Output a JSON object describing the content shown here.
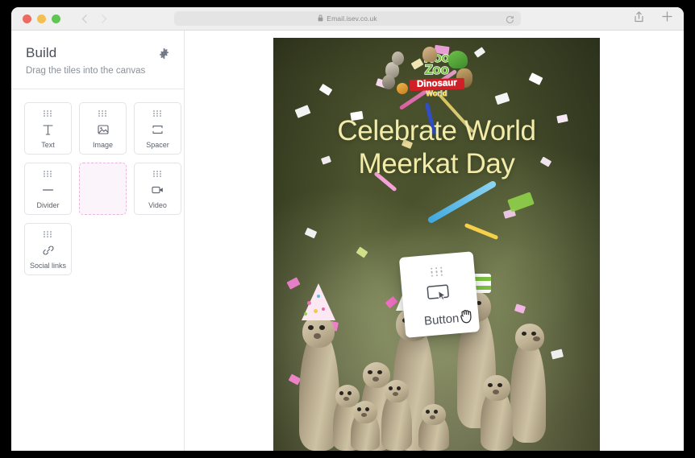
{
  "browser": {
    "window_controls": [
      "close",
      "minimize",
      "maximize"
    ],
    "url": "Email.isev.co.uk",
    "lock_icon": "lock-icon",
    "reload_icon": "reload-icon",
    "share_icon": "share-icon",
    "new_tab_icon": "plus-icon",
    "back_icon": "chevron-left-icon",
    "forward_icon": "chevron-right-icon"
  },
  "sidebar": {
    "title": "Build",
    "subtitle": "Drag the tiles into the canvas",
    "settings_icon": "gear-icon",
    "tiles": [
      {
        "label": "Text",
        "icon": "text-icon",
        "state": "normal"
      },
      {
        "label": "Image",
        "icon": "image-icon",
        "state": "normal"
      },
      {
        "label": "Spacer",
        "icon": "spacer-icon",
        "state": "normal"
      },
      {
        "label": "Divider",
        "icon": "divider-icon",
        "state": "normal"
      },
      {
        "label": "",
        "icon": "",
        "state": "empty-placeholder"
      },
      {
        "label": "Video",
        "icon": "video-icon",
        "state": "normal"
      },
      {
        "label": "Social links",
        "icon": "link-icon",
        "state": "normal"
      }
    ]
  },
  "drag": {
    "label": "Button",
    "icon": "button-cursor-icon",
    "cursor": "grabbing-hand-icon"
  },
  "email": {
    "logo": {
      "line1": "Hoo",
      "line2": "Zoo",
      "line3": "Dinosaur",
      "line4": "World",
      "ampersand": "&"
    },
    "headline_line1": "Celebrate World",
    "headline_line2": "Meerkat Day",
    "headline_color": "#f2eca8",
    "photo_description": "meerkats-with-party-hats"
  },
  "colors": {
    "accent_pink": "#e9b6e0",
    "placeholder_fill": "#fcf4fb",
    "logo_green": "#7ac143",
    "logo_red": "#cf2027",
    "logo_yellow": "#f6d332",
    "sidebar_text": "#4a4f58"
  }
}
